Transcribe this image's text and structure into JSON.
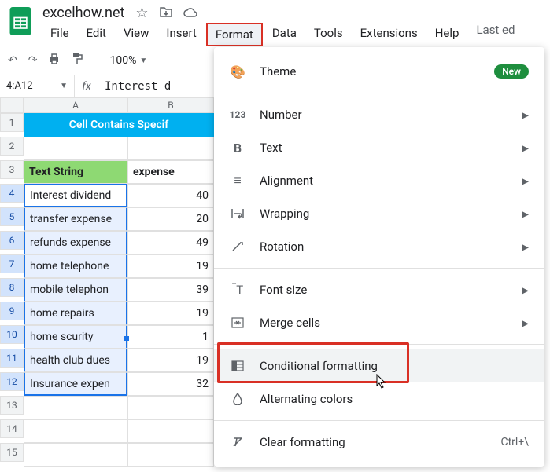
{
  "doc": {
    "title": "excelhow.net",
    "last_edit": "Last ed"
  },
  "menus": [
    "File",
    "Edit",
    "View",
    "Insert",
    "Format",
    "Data",
    "Tools",
    "Extensions",
    "Help"
  ],
  "active_menu_index": 4,
  "toolbar": {
    "zoom": "100%"
  },
  "name_box": "4:A12",
  "formula": "Interest d",
  "columns": [
    "A",
    "B"
  ],
  "title_cell": "Cell Contains Specif",
  "headers": {
    "a": "Text String",
    "b": "expense"
  },
  "rows": [
    {
      "n": 4,
      "a": "Interest dividend",
      "b": "40"
    },
    {
      "n": 5,
      "a": "transfer expense",
      "b": "20"
    },
    {
      "n": 6,
      "a": "refunds expense",
      "b": "49"
    },
    {
      "n": 7,
      "a": "home telephone",
      "b": "19"
    },
    {
      "n": 8,
      "a": "mobile telephon",
      "b": "39"
    },
    {
      "n": 9,
      "a": "home repairs",
      "b": "19"
    },
    {
      "n": 10,
      "a": "home scurity",
      "b": "1"
    },
    {
      "n": 11,
      "a": "health club dues",
      "b": "19"
    },
    {
      "n": 12,
      "a": "Insurance expen",
      "b": "32"
    }
  ],
  "dropdown": {
    "theme": "Theme",
    "new_badge": "New",
    "number": "Number",
    "text": "Text",
    "alignment": "Alignment",
    "wrapping": "Wrapping",
    "rotation": "Rotation",
    "font_size": "Font size",
    "merge": "Merge cells",
    "conditional": "Conditional formatting",
    "alternating": "Alternating colors",
    "clear": "Clear formatting",
    "clear_shortcut": "Ctrl+\\"
  },
  "chev": "▸"
}
